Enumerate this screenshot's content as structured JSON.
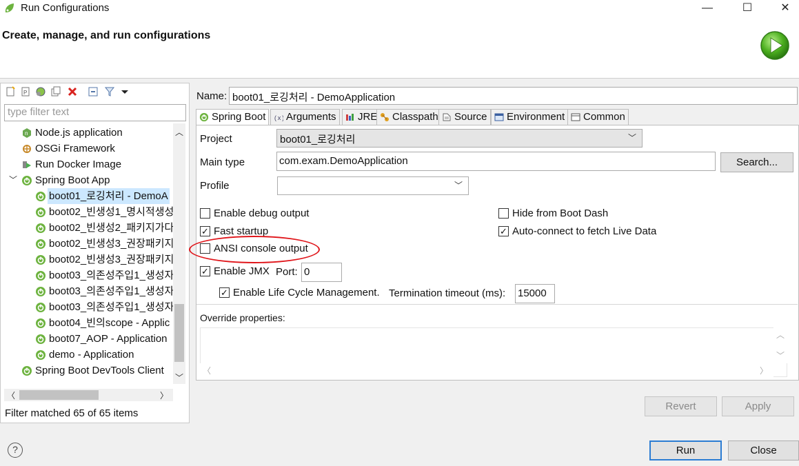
{
  "window": {
    "title": "Run Configurations",
    "minimize_glyph": "—",
    "maximize_glyph": "☐",
    "close_glyph": "✕"
  },
  "header": {
    "heading": "Create, manage, and run configurations"
  },
  "left": {
    "filter_placeholder": "type filter text",
    "tree": [
      {
        "label": "Node.js application",
        "icon": "nodejs-icon"
      },
      {
        "label": "OSGi Framework",
        "icon": "osgi-icon"
      },
      {
        "label": "Run Docker Image",
        "icon": "docker-icon"
      },
      {
        "label": "Spring Boot App",
        "icon": "spring-boot-icon",
        "expanded": true
      },
      {
        "label": "boot01_로깅처리 - DemoA",
        "icon": "spring-boot-icon",
        "selected": true
      },
      {
        "label": "boot02_빈생성1_명시적생성",
        "icon": "spring-boot-icon"
      },
      {
        "label": "boot02_빈생성2_패키지가다",
        "icon": "spring-boot-icon"
      },
      {
        "label": "boot02_빈생성3_권장패키지",
        "icon": "spring-boot-icon"
      },
      {
        "label": "boot02_빈생성3_권장패키지",
        "icon": "spring-boot-icon"
      },
      {
        "label": "boot03_의존성주입1_생성자",
        "icon": "spring-boot-icon"
      },
      {
        "label": "boot03_의존성주입1_생성자",
        "icon": "spring-boot-icon"
      },
      {
        "label": "boot03_의존성주입1_생성자",
        "icon": "spring-boot-icon"
      },
      {
        "label": "boot04_빈의scope - Applic",
        "icon": "spring-boot-icon"
      },
      {
        "label": "boot07_AOP - Application",
        "icon": "spring-boot-icon"
      },
      {
        "label": "demo - Application",
        "icon": "spring-boot-icon"
      },
      {
        "label": "Spring Boot DevTools Client",
        "icon": "spring-boot-icon"
      }
    ],
    "filter_status": "Filter matched 65 of 65 items"
  },
  "config": {
    "name_label": "Name:",
    "name_value": "boot01_로깅처리 - DemoApplication",
    "tabs": [
      {
        "label": "Spring Boot",
        "icon": "spring-boot-icon"
      },
      {
        "label": "Arguments",
        "icon": "arguments-icon"
      },
      {
        "label": "JRE",
        "icon": "jre-icon"
      },
      {
        "label": "Classpath",
        "icon": "classpath-icon"
      },
      {
        "label": "Source",
        "icon": "source-icon"
      },
      {
        "label": "Environment",
        "icon": "environment-icon"
      },
      {
        "label": "Common",
        "icon": "common-icon"
      }
    ],
    "project_label": "Project",
    "project_value": "boot01_로깅처리",
    "main_type_label": "Main type",
    "main_type_value": "com.exam.DemoApplication",
    "search_button": "Search...",
    "profile_label": "Profile",
    "profile_value": "",
    "checkboxes": {
      "enable_debug": {
        "label": "Enable debug output",
        "checked": false
      },
      "hide_boot_dash": {
        "label": "Hide from Boot Dash",
        "checked": false
      },
      "fast_startup": {
        "label": "Fast startup",
        "checked": true
      },
      "auto_connect": {
        "label": "Auto-connect to fetch Live Data",
        "checked": true
      },
      "ansi_console": {
        "label": "ANSI console output",
        "checked": false
      },
      "enable_jmx": {
        "label": "Enable JMX",
        "checked": true
      },
      "lifecycle": {
        "label": "Enable Life Cycle Management.",
        "checked": true
      }
    },
    "port_label": "Port:",
    "port_value": "0",
    "termination_label": "Termination timeout (ms):",
    "termination_value": "15000",
    "override_label": "Override properties:",
    "override_value": ""
  },
  "buttons": {
    "revert": "Revert",
    "apply": "Apply",
    "run": "Run",
    "close": "Close"
  },
  "colors": {
    "selection": "#cce8ff",
    "highlight_circle": "#e0161b",
    "spring_green": "#6db33f"
  }
}
